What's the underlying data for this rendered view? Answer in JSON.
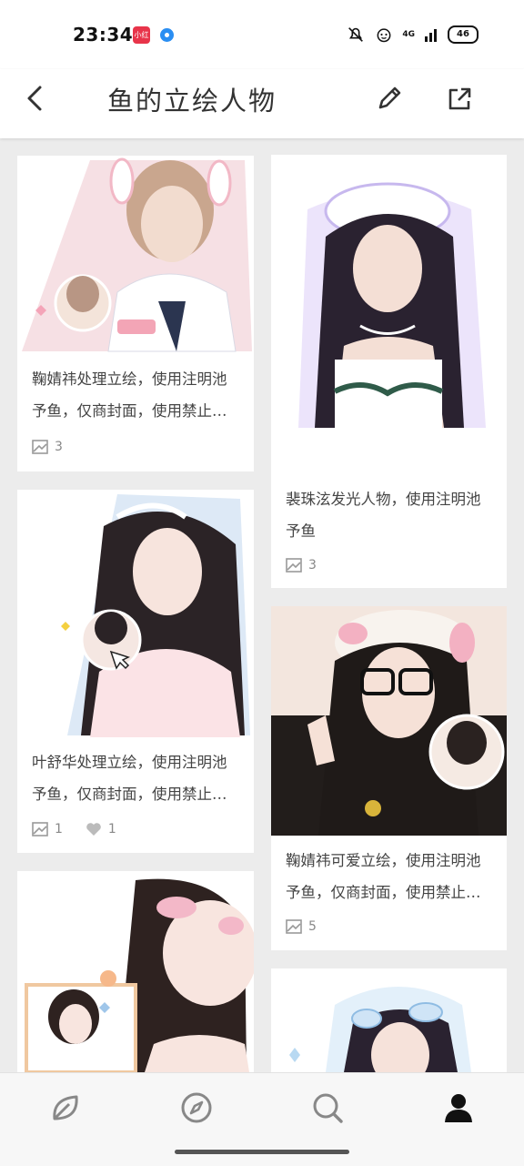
{
  "status_bar": {
    "time": "23:34",
    "app_icon_text": "小红书",
    "network_label": "4G",
    "battery": "46"
  },
  "header": {
    "title": "鱼的立绘人物",
    "back_icon": "chevron-left-icon",
    "edit_icon": "pencil-icon",
    "share_icon": "share-external-icon"
  },
  "cards": [
    {
      "text": "鞠婧祎处理立绘，使用注明池予鱼，仅商封面，使用禁止二改",
      "images": "3",
      "likes": null,
      "img_colors": [
        "#f4dbe0",
        "#ffffff",
        "#b89684"
      ]
    },
    {
      "text": "裴珠泫发光人物，使用注明池予鱼",
      "images": "3",
      "likes": null,
      "img_colors": [
        "#e6defa",
        "#ffffff",
        "#2a2230"
      ]
    },
    {
      "text": "叶舒华处理立绘，使用注明池予鱼，仅商封面，使用禁止二改",
      "images": "1",
      "likes": "1",
      "img_colors": [
        "#dfeaf6",
        "#fbe3e6",
        "#2b2326"
      ]
    },
    {
      "text": "鞠婧祎可爱立绘，使用注明池予鱼，仅商封面，使用禁止二改",
      "images": "5",
      "likes": null,
      "img_colors": [
        "#f3e4da",
        "#ffffff",
        "#1f1a18"
      ]
    },
    {
      "text": "",
      "images": null,
      "likes": null,
      "img_colors": [
        "#fde9ee",
        "#ffffff",
        "#2e2220"
      ]
    },
    {
      "text": "",
      "images": null,
      "likes": null,
      "img_colors": [
        "#e3f0fa",
        "#ffffff",
        "#2a2230"
      ]
    }
  ],
  "bottom_nav": [
    {
      "name": "home",
      "icon": "leaf-icon"
    },
    {
      "name": "discover",
      "icon": "compass-icon"
    },
    {
      "name": "search",
      "icon": "search-icon"
    },
    {
      "name": "profile",
      "icon": "person-icon"
    }
  ],
  "colors": {
    "accent": "#111111",
    "text": "#333333",
    "meta": "#888888",
    "background": "#ececec"
  }
}
